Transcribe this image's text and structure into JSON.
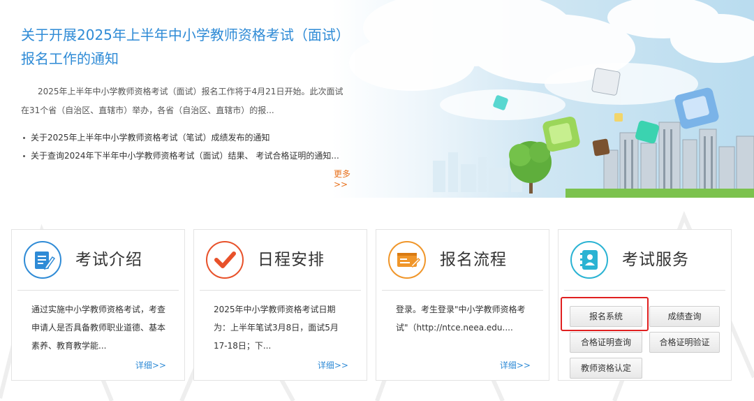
{
  "banner": {
    "title": "关于开展2025年上半年中小学教师资格考试（面试）报名工作的通知",
    "summary": "2025年上半年中小学教师资格考试（面试）报名工作将于4月21日开始。此次面试在31个省（自治区、直辖市）举办，各省（自治区、直辖市）的报...",
    "news": [
      "关于2025年上半年中小学教师资格考试（笔试）成绩发布的通知",
      "关于查询2024年下半年中小学教师资格考试（面试）结果、 考试合格证明的通知..."
    ],
    "more": "更多>>"
  },
  "cards": [
    {
      "title": "考试介绍",
      "icon": "document-edit-icon",
      "color": "#2f8bd6",
      "body": "通过实施中小学教师资格考试，考查申请人是否具备教师职业道德、基本素养、教育教学能...",
      "link": "详细>>"
    },
    {
      "title": "日程安排",
      "icon": "checkmark-icon",
      "color": "#e8512a",
      "body": "2025年中小学教师资格考试日期为：上半年笔试3月8日，面试5月17-18日；下...",
      "link": "详细>>"
    },
    {
      "title": "报名流程",
      "icon": "form-pen-icon",
      "color": "#f0962a",
      "body": "登录。考生登录\"中小学教师资格考试\"（http://ntce.neea.edu....",
      "link": "详细>>"
    },
    {
      "title": "考试服务",
      "icon": "contact-book-icon",
      "color": "#2ab3d3",
      "buttons": [
        "报名系统",
        "成绩查询",
        "合格证明查询",
        "合格证明验证",
        "教师资格认定"
      ]
    }
  ],
  "colors": {
    "link_blue": "#2f8bd6",
    "more_orange": "#e8711c",
    "highlight_red": "#e02020"
  }
}
